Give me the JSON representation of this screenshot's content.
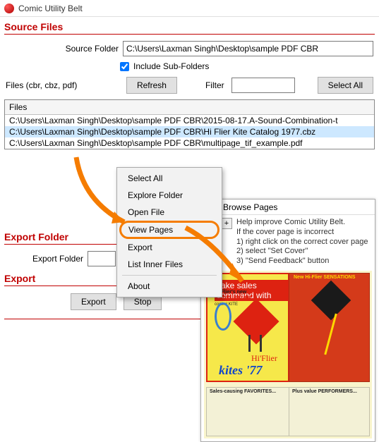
{
  "window": {
    "title": "Comic Utility Belt"
  },
  "source": {
    "header": "Source Files",
    "folder_label": "Source Folder",
    "folder_value": "C:\\Users\\Laxman Singh\\Desktop\\sample PDF CBR",
    "include_label": "Include Sub-Folders",
    "include_checked": true,
    "files_label": "Files (cbr, cbz, pdf)",
    "refresh": "Refresh",
    "filter_label": "Filter",
    "filter_value": "",
    "select_all": "Select All"
  },
  "table": {
    "header": "Files",
    "rows": [
      "C:\\Users\\Laxman Singh\\Desktop\\sample PDF CBR\\2015-08-17.A-Sound-Combination-t",
      "C:\\Users\\Laxman Singh\\Desktop\\sample PDF CBR\\Hi Flier Kite Catalog 1977.cbz",
      "C:\\Users\\Laxman Singh\\Desktop\\sample PDF CBR\\multipage_tif_example.pdf"
    ],
    "selected": 1
  },
  "context": {
    "items": [
      "Select All",
      "Explore Folder",
      "Open File",
      "View Pages",
      "Export",
      "List Inner Files",
      "About"
    ],
    "highlight": 3
  },
  "exportFolder": {
    "header": "Export Folder",
    "label": "Export Folder",
    "value": ""
  },
  "export": {
    "header": "Export",
    "export_btn": "Export",
    "stop_btn": "Stop"
  },
  "browse": {
    "title": "Browse Pages",
    "help": [
      "Help improve Comic Utility Belt.",
      "If the cover page is incorrect",
      "1) right click on the correct cover page",
      "2) select \"Set Cover\"",
      "3) \"Send Feedback\" button"
    ],
    "cover": {
      "line1": "Take sales command with",
      "line2": "Hi-Flier's new",
      "line3": "SUP'R-STUNT",
      "line4": "control KITE",
      "brand": "Hi'Flier",
      "logo": "kites '77",
      "tr_cap": "New Hi-Flier SENSATIONS",
      "bl_cap": "Sales-causing FAVORITES...",
      "br_cap": "Plus value PERFORMERS..."
    }
  }
}
